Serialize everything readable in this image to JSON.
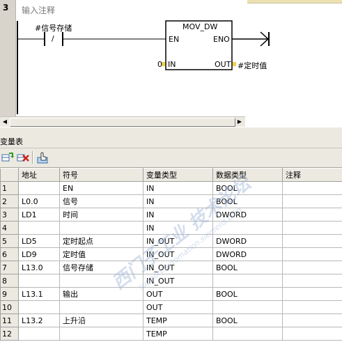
{
  "network": {
    "number": "3",
    "comment": "输入注释",
    "contact_variable": "#信号存储",
    "contact_symbol": "/",
    "box_title": "MOV_DW",
    "pin_en": "EN",
    "pin_eno": "ENO",
    "pin_in": "IN",
    "pin_out": "OUT",
    "in_value": "0",
    "out_variable": "#定时值"
  },
  "variable_table": {
    "title": "变量表",
    "headers": [
      "地址",
      "符号",
      "变量类型",
      "数据类型",
      "注释"
    ],
    "rows": [
      {
        "num": "1",
        "address": "",
        "symbol": "EN",
        "var_type": "IN",
        "data_type": "BOOL",
        "comment": ""
      },
      {
        "num": "2",
        "address": "L0.0",
        "symbol": "信号",
        "var_type": "IN",
        "data_type": "BOOL",
        "comment": ""
      },
      {
        "num": "3",
        "address": "LD1",
        "symbol": "时间",
        "var_type": "IN",
        "data_type": "DWORD",
        "comment": ""
      },
      {
        "num": "4",
        "address": "",
        "symbol": "",
        "var_type": "IN",
        "data_type": "",
        "comment": ""
      },
      {
        "num": "5",
        "address": "LD5",
        "symbol": "定时起点",
        "var_type": "IN_OUT",
        "data_type": "DWORD",
        "comment": ""
      },
      {
        "num": "6",
        "address": "LD9",
        "symbol": "定时值",
        "var_type": "IN_OUT",
        "data_type": "DWORD",
        "comment": ""
      },
      {
        "num": "7",
        "address": "L13.0",
        "symbol": "信号存储",
        "var_type": "IN_OUT",
        "data_type": "BOOL",
        "comment": ""
      },
      {
        "num": "8",
        "address": "",
        "symbol": "",
        "var_type": "IN_OUT",
        "data_type": "",
        "comment": ""
      },
      {
        "num": "9",
        "address": "L13.1",
        "symbol": "输出",
        "var_type": "OUT",
        "data_type": "BOOL",
        "comment": ""
      },
      {
        "num": "10",
        "address": "",
        "symbol": "",
        "var_type": "OUT",
        "data_type": "",
        "comment": ""
      },
      {
        "num": "11",
        "address": "L13.2",
        "symbol": "上升沿",
        "var_type": "TEMP",
        "data_type": "BOOL",
        "comment": ""
      },
      {
        "num": "12",
        "address": "",
        "symbol": "",
        "var_type": "TEMP",
        "data_type": "",
        "comment": ""
      }
    ]
  },
  "toolbar": {
    "insert_icon": "insert-row-icon",
    "delete_icon": "delete-row-icon",
    "help_icon": "help-hand-icon"
  },
  "scrollbar": {
    "left_arrow": "◀",
    "right_arrow": "▶"
  },
  "watermark": {
    "line1": "西门子工业 技术论坛",
    "line2": "support.automation.siemens.com"
  },
  "colors": {
    "chrome": "#ece9e1",
    "gutter": "#d8d4cc",
    "pin_marker": "#f0d050",
    "watermark": "#9fb4d8"
  }
}
